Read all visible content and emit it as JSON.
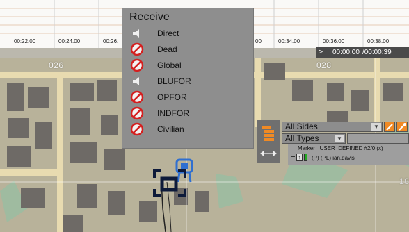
{
  "timeline": {
    "ticks": [
      "00:22.00",
      "00:24.00",
      "00:26.",
      "00",
      "00:34.00",
      "00:36.00",
      "00:38.00"
    ],
    "current_time": "00:00:00",
    "total_time": "/00:00:39",
    "chevron": ">"
  },
  "grid_labels": [
    "026",
    "028",
    "18"
  ],
  "receive_menu": {
    "title": "Receive",
    "items": [
      {
        "label": "Direct",
        "icon": "speaker-icon"
      },
      {
        "label": "Dead",
        "icon": "blocked-icon"
      },
      {
        "label": "Global",
        "icon": "blocked-icon"
      },
      {
        "label": "BLUFOR",
        "icon": "speaker-icon"
      },
      {
        "label": "OPFOR",
        "icon": "blocked-icon"
      },
      {
        "label": "INDFOR",
        "icon": "blocked-icon"
      },
      {
        "label": "Civilian",
        "icon": "blocked-icon"
      }
    ]
  },
  "filter": {
    "sides_value": "All Sides",
    "types_value": "All Types",
    "marker_line": "Marker _USER_DEFINED #2/0 (x)",
    "player_line": "(P) (PL) ian.davis"
  },
  "colors": {
    "blocked": "#d42020",
    "player_green": "#22aa22",
    "unit_blue": "#2f6fd0",
    "selection": "#0d1a3a"
  }
}
